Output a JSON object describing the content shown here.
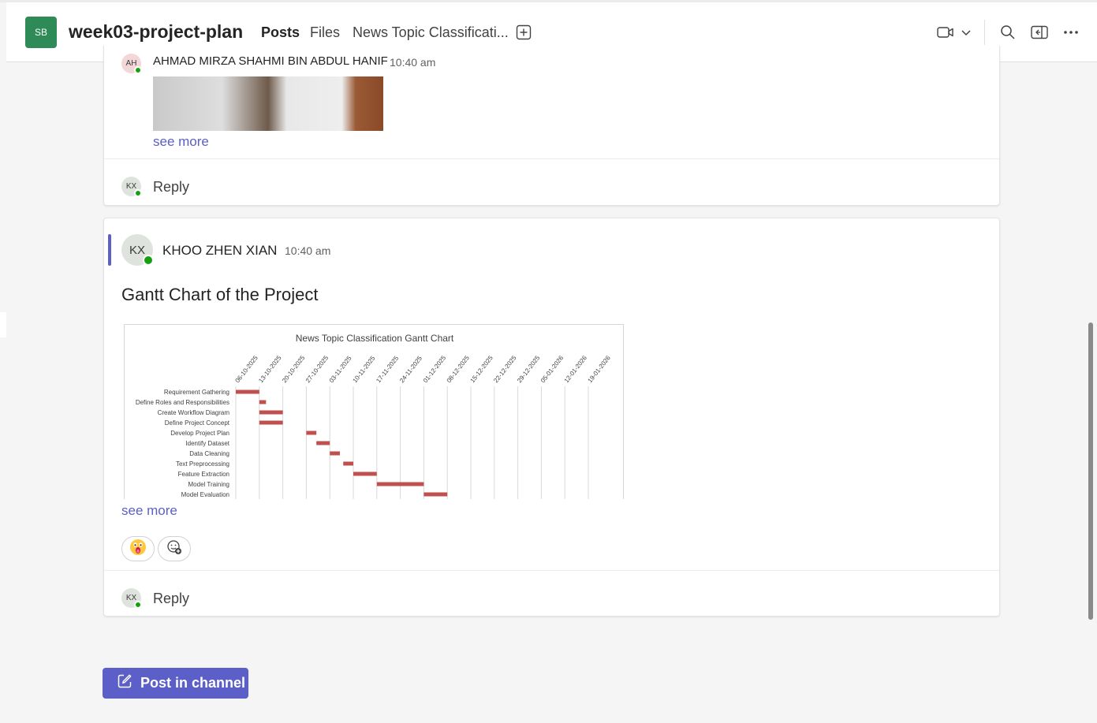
{
  "header": {
    "team_avatar": "SB",
    "channel_title": "week03-project-plan",
    "tabs": [
      {
        "label": "Posts",
        "active": true
      },
      {
        "label": "Files",
        "active": false
      },
      {
        "label": "News Topic Classificati...",
        "active": false
      }
    ],
    "icons": [
      "add-tab-icon",
      "video-call-icon",
      "chevron-down-icon",
      "search-icon",
      "open-panel-icon",
      "more-options-icon"
    ]
  },
  "posts": [
    {
      "avatar": "AH",
      "sender": "AHMAD MIRZA SHAHMI BIN ABDUL HANIF",
      "time": "10:40 am",
      "see_more": "see more",
      "reply": {
        "avatar": "KX",
        "label": "Reply"
      }
    },
    {
      "avatar": "KX",
      "sender": "KHOO ZHEN XIAN",
      "time": "10:40 am",
      "title": "Gantt Chart of the Project",
      "see_more": "see more",
      "reactions": [
        "surprised-emoji-icon",
        "add-reaction-icon"
      ],
      "reply": {
        "avatar": "KX",
        "label": "Reply"
      }
    }
  ],
  "compose": {
    "post_label": "Post in channel"
  },
  "colors": {
    "accent": "#5b5fc7",
    "presence": "#13a10e",
    "gantt_bar": "#c0504d",
    "team": "#2e8b57"
  },
  "chart_data": {
    "type": "gantt",
    "title": "News Topic Classification Gantt Chart",
    "x_ticks": [
      "06-10-2025",
      "13-10-2025",
      "20-10-2025",
      "27-10-2025",
      "03-11-2025",
      "10-11-2025",
      "17-11-2025",
      "24-11-2025",
      "01-12-2025",
      "08-12-2025",
      "15-12-2025",
      "22-12-2025",
      "29-12-2025",
      "05-01-2026",
      "12-01-2026",
      "19-01-2026"
    ],
    "tasks": [
      {
        "name": "Requirement Gathering",
        "start": "2025-10-06",
        "end": "2025-10-13"
      },
      {
        "name": "Define Roles and Responsibilities",
        "start": "2025-10-13",
        "end": "2025-10-15"
      },
      {
        "name": "Create Workflow Diagram",
        "start": "2025-10-13",
        "end": "2025-10-20"
      },
      {
        "name": "Define Project Concept",
        "start": "2025-10-13",
        "end": "2025-10-20"
      },
      {
        "name": "Develop Project Plan",
        "start": "2025-10-27",
        "end": "2025-10-30"
      },
      {
        "name": "Identify Dataset",
        "start": "2025-10-30",
        "end": "2025-11-03"
      },
      {
        "name": "Data Cleaning",
        "start": "2025-11-03",
        "end": "2025-11-06"
      },
      {
        "name": "Text Preprocessing",
        "start": "2025-11-07",
        "end": "2025-11-10"
      },
      {
        "name": "Feature Extraction",
        "start": "2025-11-10",
        "end": "2025-11-17"
      },
      {
        "name": "Model Training",
        "start": "2025-11-17",
        "end": "2025-12-01"
      },
      {
        "name": "Model Evaluation",
        "start": "2025-12-01",
        "end": "2025-12-08"
      }
    ],
    "grid": true
  }
}
